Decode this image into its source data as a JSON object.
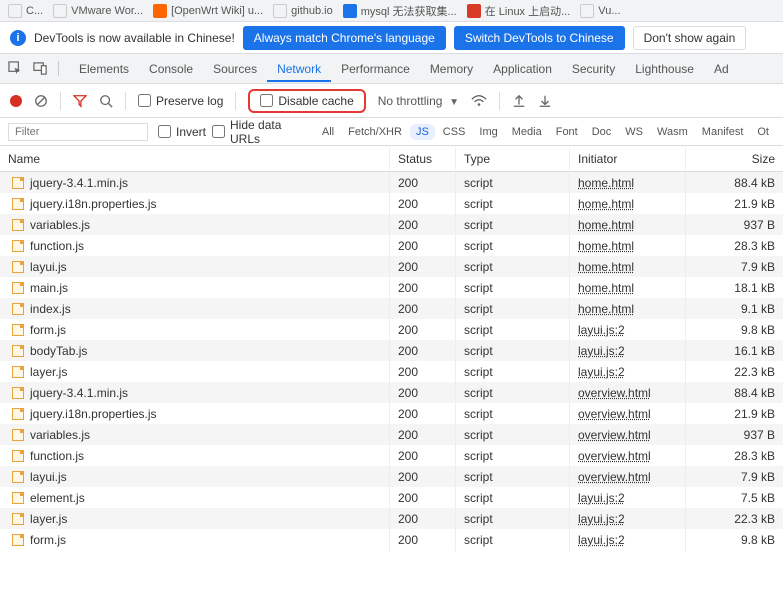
{
  "bookmarks": [
    {
      "label": "C...",
      "cls": "none"
    },
    {
      "label": "VMware Wor...",
      "cls": "none"
    },
    {
      "label": "[OpenWrt Wiki] u...",
      "cls": "orange"
    },
    {
      "label": "github.io",
      "cls": "none"
    },
    {
      "label": "mysql 无法获取集...",
      "cls": "blue"
    },
    {
      "label": "在 Linux 上启动...",
      "cls": "red"
    },
    {
      "label": "Vu...",
      "cls": "none"
    }
  ],
  "infoBar": {
    "message": "DevTools is now available in Chinese!",
    "btn1": "Always match Chrome's language",
    "btn2": "Switch DevTools to Chinese",
    "btn3": "Don't show again"
  },
  "tabs": [
    "Elements",
    "Console",
    "Sources",
    "Network",
    "Performance",
    "Memory",
    "Application",
    "Security",
    "Lighthouse",
    "Ad"
  ],
  "activeTab": "Network",
  "toolbar": {
    "preserveLog": "Preserve log",
    "disableCache": "Disable cache",
    "throttling": "No throttling"
  },
  "filterBar": {
    "placeholder": "Filter",
    "invert": "Invert",
    "hideData": "Hide data URLs",
    "pills": [
      "All",
      "Fetch/XHR",
      "JS",
      "CSS",
      "Img",
      "Media",
      "Font",
      "Doc",
      "WS",
      "Wasm",
      "Manifest",
      "Ot"
    ],
    "activePill": "JS"
  },
  "headers": {
    "name": "Name",
    "status": "Status",
    "type": "Type",
    "initiator": "Initiator",
    "size": "Size"
  },
  "rows": [
    {
      "name": "jquery-3.4.1.min.js",
      "status": "200",
      "type": "script",
      "initiator": "home.html",
      "size": "88.4 kB"
    },
    {
      "name": "jquery.i18n.properties.js",
      "status": "200",
      "type": "script",
      "initiator": "home.html",
      "size": "21.9 kB"
    },
    {
      "name": "variables.js",
      "status": "200",
      "type": "script",
      "initiator": "home.html",
      "size": "937 B"
    },
    {
      "name": "function.js",
      "status": "200",
      "type": "script",
      "initiator": "home.html",
      "size": "28.3 kB"
    },
    {
      "name": "layui.js",
      "status": "200",
      "type": "script",
      "initiator": "home.html",
      "size": "7.9 kB"
    },
    {
      "name": "main.js",
      "status": "200",
      "type": "script",
      "initiator": "home.html",
      "size": "18.1 kB"
    },
    {
      "name": "index.js",
      "status": "200",
      "type": "script",
      "initiator": "home.html",
      "size": "9.1 kB"
    },
    {
      "name": "form.js",
      "status": "200",
      "type": "script",
      "initiator": "layui.js:2",
      "size": "9.8 kB"
    },
    {
      "name": "bodyTab.js",
      "status": "200",
      "type": "script",
      "initiator": "layui.js:2",
      "size": "16.1 kB"
    },
    {
      "name": "layer.js",
      "status": "200",
      "type": "script",
      "initiator": "layui.js:2",
      "size": "22.3 kB"
    },
    {
      "name": "jquery-3.4.1.min.js",
      "status": "200",
      "type": "script",
      "initiator": "overview.html",
      "size": "88.4 kB"
    },
    {
      "name": "jquery.i18n.properties.js",
      "status": "200",
      "type": "script",
      "initiator": "overview.html",
      "size": "21.9 kB"
    },
    {
      "name": "variables.js",
      "status": "200",
      "type": "script",
      "initiator": "overview.html",
      "size": "937 B"
    },
    {
      "name": "function.js",
      "status": "200",
      "type": "script",
      "initiator": "overview.html",
      "size": "28.3 kB"
    },
    {
      "name": "layui.js",
      "status": "200",
      "type": "script",
      "initiator": "overview.html",
      "size": "7.9 kB"
    },
    {
      "name": "element.js",
      "status": "200",
      "type": "script",
      "initiator": "layui.js:2",
      "size": "7.5 kB"
    },
    {
      "name": "layer.js",
      "status": "200",
      "type": "script",
      "initiator": "layui.js:2",
      "size": "22.3 kB"
    },
    {
      "name": "form.js",
      "status": "200",
      "type": "script",
      "initiator": "layui.js:2",
      "size": "9.8 kB"
    }
  ]
}
